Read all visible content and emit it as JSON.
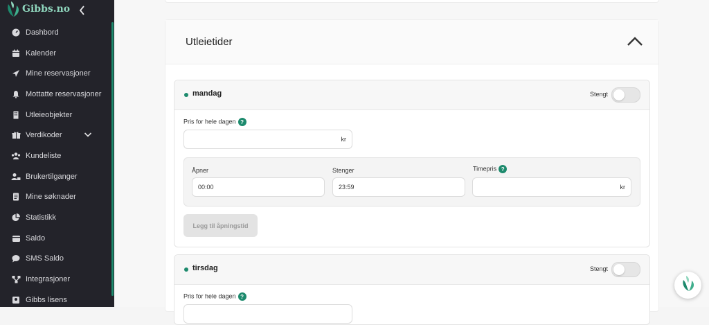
{
  "brand": {
    "name": "Gibbs.no",
    "logo_icon": "gibbs-leaf-logo-icon",
    "collapse_icon": "chevron-left-icon"
  },
  "colors": {
    "accent": "#1d8a6d",
    "sidebar_bg": "#23232a",
    "sidebar_text": "#d8d8dc"
  },
  "sidebar": {
    "items": [
      {
        "label": "Dashbord",
        "icon": "dashboard-gauge-icon"
      },
      {
        "label": "Kalender",
        "icon": "calendar-icon"
      },
      {
        "label": "Mine reservasjoner",
        "icon": "paper-plane-icon"
      },
      {
        "label": "Mottatte reservasjoner",
        "icon": "bell-icon"
      },
      {
        "label": "Utleieobjekter",
        "icon": "building-icon"
      },
      {
        "label": "Verdikoder",
        "icon": "gift-icon",
        "expand_icon": "chevron-down-icon"
      },
      {
        "label": "Kundeliste",
        "icon": "users-icon"
      },
      {
        "label": "Brukertilganger",
        "icon": "user-lock-icon"
      },
      {
        "label": "Mine søknader",
        "icon": "document-icon"
      },
      {
        "label": "Statistikk",
        "icon": "pie-chart-icon"
      },
      {
        "label": "Saldo",
        "icon": "wallet-icon"
      },
      {
        "label": "SMS Saldo",
        "icon": "chat-bubble-icon"
      },
      {
        "label": "Integrasjoner",
        "icon": "integration-icon"
      },
      {
        "label": "Gibbs lisens",
        "icon": "license-icon"
      }
    ]
  },
  "section": {
    "title": "Utleietider",
    "collapse_icon": "chevron-up-icon"
  },
  "days": [
    {
      "name": "mandag",
      "closed_label": "Stengt",
      "closed": false,
      "full_day_price_label": "Pris for hele dagen",
      "full_day_price_value": "",
      "currency": "kr",
      "opens_label": "Åpner",
      "opens_value": "00:00",
      "closes_label": "Stenger",
      "closes_value": "23:59",
      "hourly_label": "Timepris",
      "hourly_value": "",
      "add_button": "Legg til åpningstid"
    },
    {
      "name": "tirsdag",
      "closed_label": "Stengt",
      "closed": false,
      "full_day_price_label": "Pris for hele dagen"
    }
  ],
  "help_glyph": "?"
}
